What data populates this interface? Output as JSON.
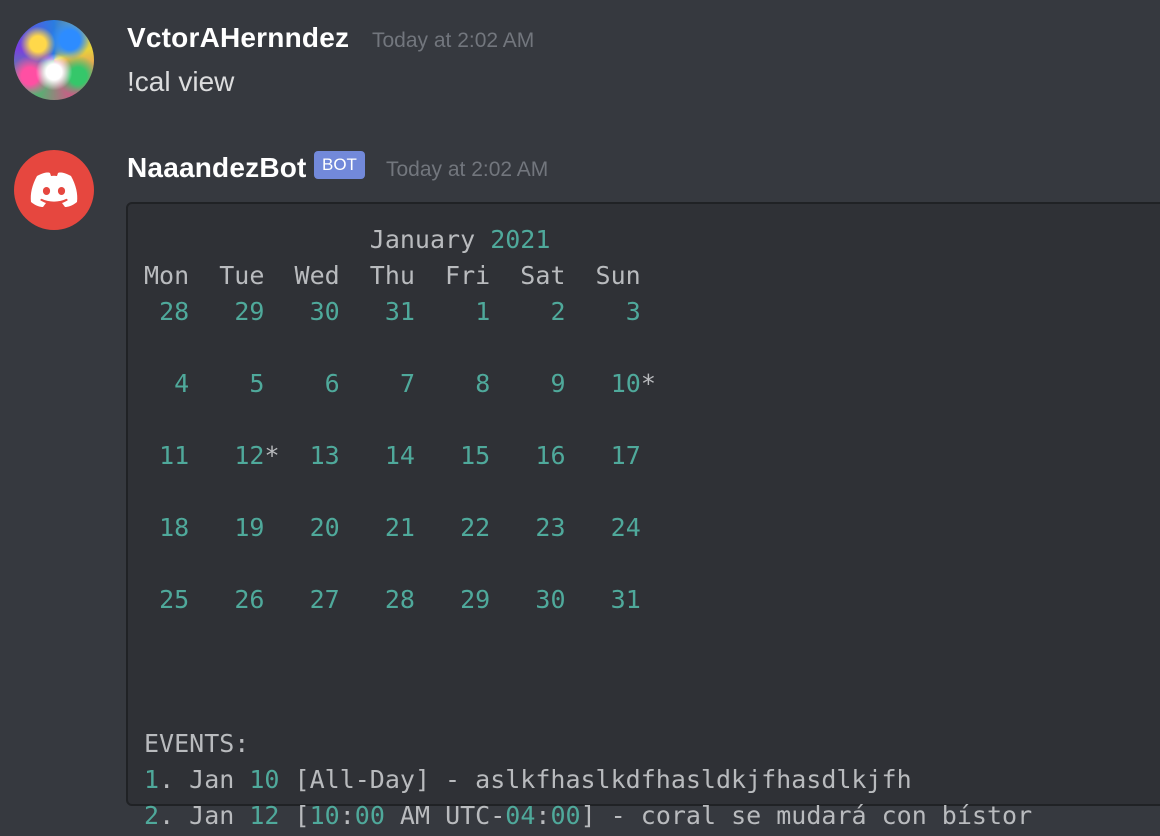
{
  "messages": {
    "user": {
      "name": "VctorAHernndez",
      "timestamp": "Today at 2:02 AM",
      "text": "!cal view"
    },
    "bot": {
      "name": "NaaandezBot",
      "tag": "BOT",
      "timestamp": "Today at 2:02 AM",
      "calendar": {
        "month": "January",
        "year": "2021",
        "weekdays": [
          "Mon",
          "Tue",
          "Wed",
          "Thu",
          "Fri",
          "Sat",
          "Sun"
        ],
        "weeks": [
          [
            "28",
            "29",
            "30",
            "31",
            "1",
            "2",
            "3"
          ],
          [
            "4",
            "5",
            "6",
            "7",
            "8",
            "9",
            "10*"
          ],
          [
            "11",
            "12*",
            "13",
            "14",
            "15",
            "16",
            "17"
          ],
          [
            "18",
            "19",
            "20",
            "21",
            "22",
            "23",
            "24"
          ],
          [
            "25",
            "26",
            "27",
            "28",
            "29",
            "30",
            "31"
          ]
        ]
      },
      "events_header": "EVENTS:",
      "events": [
        "1. Jan 10 [All-Day] - aslkfhaslkdfhasldkjfhasdlkjfh",
        "2. Jan 12 [10:00 AM UTC-04:00] - coral se mudará con bístor"
      ]
    }
  },
  "icons": {
    "bot_avatar": "discord-logo-icon"
  },
  "colors": {
    "background": "#36393f",
    "codeblock_bg": "#2f3136",
    "number_accent": "#4fa99b",
    "bot_tag": "#7289da",
    "bot_avatar_bg": "#e6473f"
  }
}
